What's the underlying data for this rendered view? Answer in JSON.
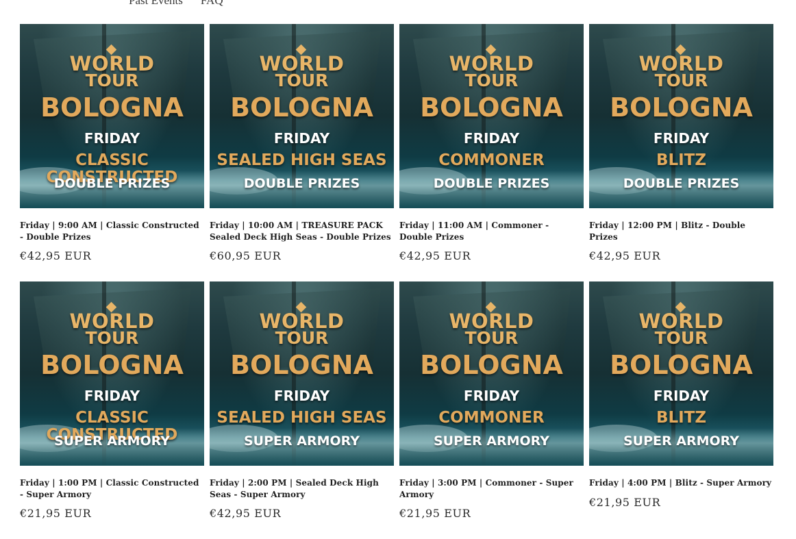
{
  "nav": {
    "items": [
      "Past Events",
      "FAQ"
    ]
  },
  "poster_common": {
    "brand_line1": "WORLD",
    "brand_line2": "TOUR",
    "city": "BOLOGNA",
    "day": "FRIDAY"
  },
  "products": [
    {
      "title": "Friday | 9:00 AM | Classic Constructed - Double Prizes",
      "price": "€42,95 EUR",
      "poster_format": "CLASSIC CONSTRUCTED",
      "poster_tag": "DOUBLE PRIZES"
    },
    {
      "title": "Friday | 10:00 AM | TREASURE PACK Sealed Deck High Seas - Double Prizes",
      "price": "€60,95 EUR",
      "poster_format": "SEALED HIGH SEAS",
      "poster_tag": "DOUBLE PRIZES"
    },
    {
      "title": "Friday | 11:00 AM | Commoner - Double Prizes",
      "price": "€42,95 EUR",
      "poster_format": "COMMONER",
      "poster_tag": "DOUBLE PRIZES"
    },
    {
      "title": "Friday | 12:00 PM | Blitz - Double Prizes",
      "price": "€42,95 EUR",
      "poster_format": "BLITZ",
      "poster_tag": "DOUBLE PRIZES"
    },
    {
      "title": "Friday | 1:00 PM | Classic Constructed - Super Armory",
      "price": "€21,95 EUR",
      "poster_format": "CLASSIC CONSTRUCTED",
      "poster_tag": "SUPER ARMORY"
    },
    {
      "title": "Friday | 2:00 PM | Sealed Deck High Seas - Super Armory",
      "price": "€42,95 EUR",
      "poster_format": "SEALED HIGH SEAS",
      "poster_tag": "SUPER ARMORY"
    },
    {
      "title": "Friday | 3:00 PM | Commoner - Super Armory",
      "price": "€21,95 EUR",
      "poster_format": "COMMONER",
      "poster_tag": "SUPER ARMORY"
    },
    {
      "title": "Friday | 4:00 PM | Blitz - Super Armory",
      "price": "€21,95 EUR",
      "poster_format": "BLITZ",
      "poster_tag": "SUPER ARMORY"
    }
  ]
}
